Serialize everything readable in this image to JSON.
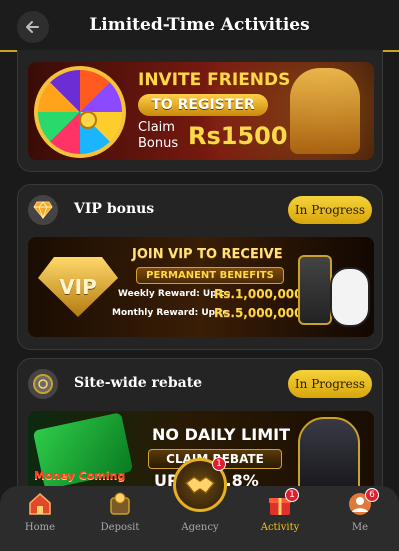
{
  "header": {
    "title": "Limited-Time Activities",
    "back_icon": "arrow-left-icon"
  },
  "activities": [
    {
      "banner": {
        "line1": "INVITE FRIENDS",
        "line2": "TO REGISTER",
        "line3a": "Claim",
        "line3b": "Bonus",
        "amount": "Rs1500"
      }
    },
    {
      "title": "VIP bonus",
      "status": "In Progress",
      "icon": "diamond-icon",
      "banner": {
        "vip": "VIP",
        "line1": "JOIN VIP TO RECEIVE",
        "line2": "PERMANENT BENEFITS",
        "weekly_label": "Weekly Reward: Up to",
        "weekly_value": "Rs.1,000,000",
        "monthly_label": "Monthly Reward: Up to",
        "monthly_value": "Rs.5,000,000"
      }
    },
    {
      "title": "Site-wide rebate",
      "status": "In Progress",
      "icon": "rebate-coin-icon",
      "banner": {
        "line1": "NO DAILY LIMIT",
        "line2": "CLAIM REBATE",
        "line3": "UP TO 0.8%",
        "brand": "Money Coming"
      }
    }
  ],
  "nav": {
    "items": [
      {
        "label": "Home",
        "icon": "home-icon"
      },
      {
        "label": "Deposit",
        "icon": "deposit-icon"
      },
      {
        "label": "Agency",
        "icon": "handshake-icon",
        "badge": "1"
      },
      {
        "label": "Activity",
        "icon": "gift-icon",
        "badge": "1"
      },
      {
        "label": "Me",
        "icon": "user-icon",
        "badge": "6"
      }
    ],
    "active": "Activity",
    "colors": {
      "active": "#f5c518",
      "inactive": "#aaaaaa",
      "badge": "#e01e2e"
    }
  }
}
